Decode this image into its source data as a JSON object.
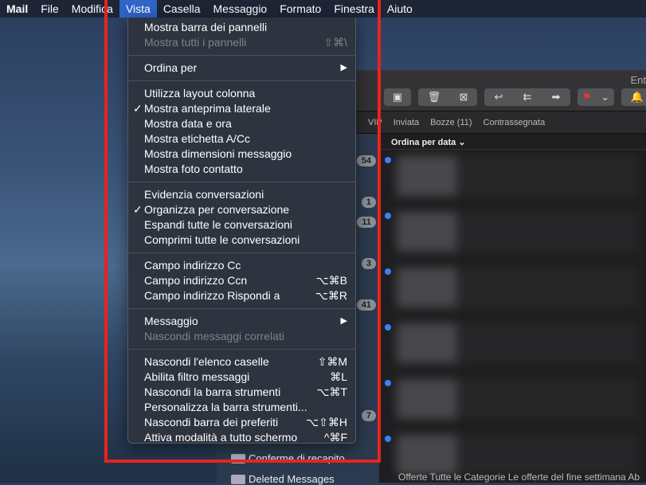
{
  "menubar": {
    "app": "Mail",
    "items": [
      "File",
      "Modifica",
      "Vista",
      "Casella",
      "Messaggio",
      "Formato",
      "Finestra",
      "Aiuto"
    ]
  },
  "window": {
    "title": "Ent",
    "favorites": [
      "VIP",
      "Inviata",
      "Bozze (11)",
      "Contrassegnata"
    ],
    "sort": "Ordina per data",
    "badges": [
      "54",
      "1",
      "11",
      "3",
      "41",
      "7"
    ],
    "folders": [
      "Conferme di recapito",
      "Deleted Messages"
    ],
    "footer_text": "Offerte Tutte le Categorie Le offerte del fine settimana Ab"
  },
  "menu": {
    "groups": [
      [
        {
          "label": "Mostra barra dei pannelli"
        },
        {
          "label": "Mostra tutti i pannelli",
          "shortcut": "⇧⌘\\",
          "disabled": true
        }
      ],
      [
        {
          "label": "Ordina per",
          "submenu": true
        }
      ],
      [
        {
          "label": "Utilizza layout colonna"
        },
        {
          "label": "Mostra anteprima laterale",
          "checked": true
        },
        {
          "label": "Mostra data e ora"
        },
        {
          "label": "Mostra etichetta A/Cc"
        },
        {
          "label": "Mostra dimensioni messaggio"
        },
        {
          "label": "Mostra foto contatto"
        }
      ],
      [
        {
          "label": "Evidenzia conversazioni"
        },
        {
          "label": "Organizza per conversazione",
          "checked": true
        },
        {
          "label": "Espandi tutte le conversazioni"
        },
        {
          "label": "Comprimi tutte le conversazioni"
        }
      ],
      [
        {
          "label": "Campo indirizzo Cc"
        },
        {
          "label": "Campo indirizzo Ccn",
          "shortcut": "⌥⌘B"
        },
        {
          "label": "Campo indirizzo Rispondi a",
          "shortcut": "⌥⌘R"
        }
      ],
      [
        {
          "label": "Messaggio",
          "submenu": true
        },
        {
          "label": "Nascondi messaggi correlati",
          "disabled": true
        }
      ],
      [
        {
          "label": "Nascondi l'elenco caselle",
          "shortcut": "⇧⌘M"
        },
        {
          "label": "Abilita filtro messaggi",
          "shortcut": "⌘L"
        },
        {
          "label": "Nascondi la barra strumenti",
          "shortcut": "⌥⌘T"
        },
        {
          "label": "Personalizza la barra strumenti..."
        },
        {
          "label": "Nascondi barra dei preferiti",
          "shortcut": "⌥⇧⌘H"
        },
        {
          "label": "Attiva modalità a tutto schermo",
          "shortcut": "^⌘F"
        }
      ]
    ]
  }
}
